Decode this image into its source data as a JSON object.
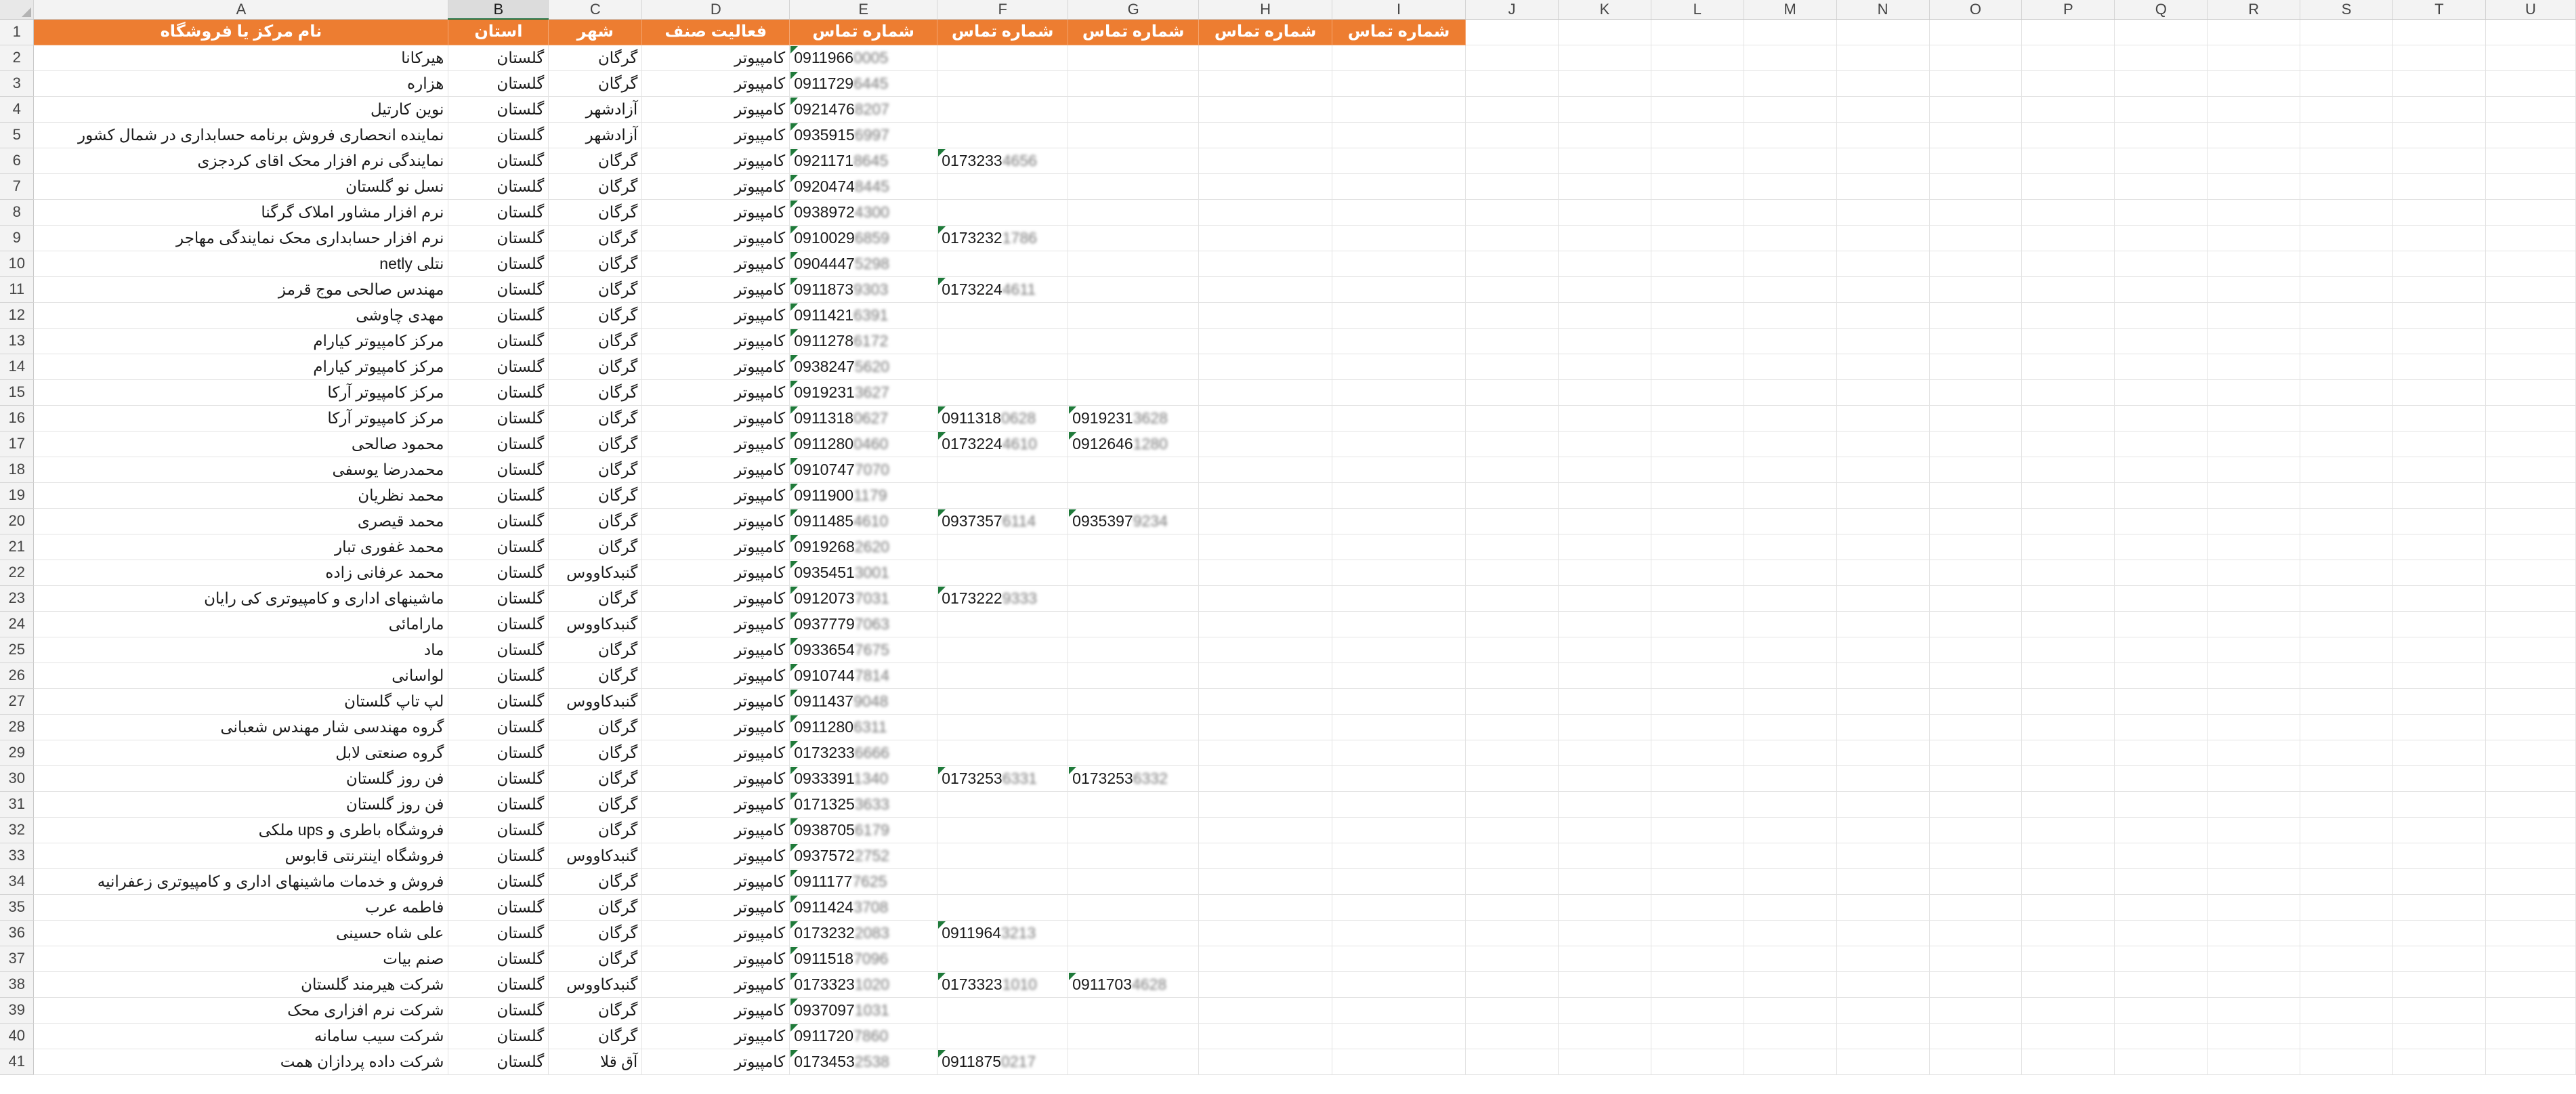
{
  "columns": [
    "A",
    "B",
    "C",
    "D",
    "E",
    "F",
    "G",
    "H",
    "I",
    "J",
    "K",
    "L",
    "M",
    "N",
    "O",
    "P",
    "Q",
    "R",
    "S",
    "T",
    "U"
  ],
  "selected_column": "B",
  "header_row": {
    "number": "1",
    "A": "نام مرکز یا فروشگاه",
    "B": "استان",
    "C": "شهر",
    "D": "فعالیت صنف",
    "E": "شماره تماس",
    "F": "شماره تماس",
    "G": "شماره تماس",
    "H": "شماره تماس",
    "I": "شماره تماس"
  },
  "rows": [
    {
      "n": "2",
      "name": "هیرکانا",
      "province": "گلستان",
      "city": "گرگان",
      "activity": "کامپیوتر",
      "e": "0911966",
      "e_blur": "0005",
      "f": "",
      "f_blur": "",
      "g": "",
      "g_blur": ""
    },
    {
      "n": "3",
      "name": "هزاره",
      "province": "گلستان",
      "city": "گرگان",
      "activity": "کامپیوتر",
      "e": "0911729",
      "e_blur": "6445",
      "f": "",
      "f_blur": "",
      "g": "",
      "g_blur": ""
    },
    {
      "n": "4",
      "name": "نوین کارتیل",
      "province": "گلستان",
      "city": "آزادشهر",
      "activity": "کامپیوتر",
      "e": "0921476",
      "e_blur": "8207",
      "f": "",
      "f_blur": "",
      "g": "",
      "g_blur": ""
    },
    {
      "n": "5",
      "name": "نماینده انحصاری فروش برنامه حسابداری در شمال کشور",
      "province": "گلستان",
      "city": "آزادشهر",
      "activity": "کامپیوتر",
      "e": "0935915",
      "e_blur": "6997",
      "f": "",
      "f_blur": "",
      "g": "",
      "g_blur": ""
    },
    {
      "n": "6",
      "name": "نمایندگی نرم افزار محک اقای کردجزی",
      "province": "گلستان",
      "city": "گرگان",
      "activity": "کامپیوتر",
      "e": "0921171",
      "e_blur": "8645",
      "f": "0173233",
      "f_blur": "4656",
      "g": "",
      "g_blur": ""
    },
    {
      "n": "7",
      "name": "نسل نو گلستان",
      "province": "گلستان",
      "city": "گرگان",
      "activity": "کامپیوتر",
      "e": "0920474",
      "e_blur": "8445",
      "f": "",
      "f_blur": "",
      "g": "",
      "g_blur": ""
    },
    {
      "n": "8",
      "name": "نرم افزار مشاور املاک گرگنا",
      "province": "گلستان",
      "city": "گرگان",
      "activity": "کامپیوتر",
      "e": "0938972",
      "e_blur": "4300",
      "f": "",
      "f_blur": "",
      "g": "",
      "g_blur": ""
    },
    {
      "n": "9",
      "name": "نرم افزار حسابداری محک نمایندگی مهاجر",
      "province": "گلستان",
      "city": "گرگان",
      "activity": "کامپیوتر",
      "e": "0910029",
      "e_blur": "6859",
      "f": "0173232",
      "f_blur": "1786",
      "g": "",
      "g_blur": ""
    },
    {
      "n": "10",
      "name": "نتلی netly",
      "province": "گلستان",
      "city": "گرگان",
      "activity": "کامپیوتر",
      "e": "0904447",
      "e_blur": "5298",
      "f": "",
      "f_blur": "",
      "g": "",
      "g_blur": ""
    },
    {
      "n": "11",
      "name": "مهندس صالحی موج قرمز",
      "province": "گلستان",
      "city": "گرگان",
      "activity": "کامپیوتر",
      "e": "0911873",
      "e_blur": "9303",
      "f": "0173224",
      "f_blur": "4611",
      "g": "",
      "g_blur": ""
    },
    {
      "n": "12",
      "name": "مهدی چاوشی",
      "province": "گلستان",
      "city": "گرگان",
      "activity": "کامپیوتر",
      "e": "0911421",
      "e_blur": "6391",
      "f": "",
      "f_blur": "",
      "g": "",
      "g_blur": ""
    },
    {
      "n": "13",
      "name": "مرکز کامپیوتر کیارام",
      "province": "گلستان",
      "city": "گرگان",
      "activity": "کامپیوتر",
      "e": "0911278",
      "e_blur": "6172",
      "f": "",
      "f_blur": "",
      "g": "",
      "g_blur": ""
    },
    {
      "n": "14",
      "name": "مرکز کامپیوتر کیارام",
      "province": "گلستان",
      "city": "گرگان",
      "activity": "کامپیوتر",
      "e": "0938247",
      "e_blur": "5620",
      "f": "",
      "f_blur": "",
      "g": "",
      "g_blur": ""
    },
    {
      "n": "15",
      "name": "مرکز کامپیوتر آرکا",
      "province": "گلستان",
      "city": "گرگان",
      "activity": "کامپیوتر",
      "e": "0919231",
      "e_blur": "3627",
      "f": "",
      "f_blur": "",
      "g": "",
      "g_blur": ""
    },
    {
      "n": "16",
      "name": "مرکز کامپیوتر آرکا",
      "province": "گلستان",
      "city": "گرگان",
      "activity": "کامپیوتر",
      "e": "0911318",
      "e_blur": "0627",
      "f": "0911318",
      "f_blur": "0628",
      "g": "0919231",
      "g_blur": "3628"
    },
    {
      "n": "17",
      "name": "محمود صالحی",
      "province": "گلستان",
      "city": "گرگان",
      "activity": "کامپیوتر",
      "e": "0911280",
      "e_blur": "0460",
      "f": "0173224",
      "f_blur": "4610",
      "g": "0912646",
      "g_blur": "1280"
    },
    {
      "n": "18",
      "name": "محمدرضا یوسفی",
      "province": "گلستان",
      "city": "گرگان",
      "activity": "کامپیوتر",
      "e": "0910747",
      "e_blur": "7070",
      "f": "",
      "f_blur": "",
      "g": "",
      "g_blur": ""
    },
    {
      "n": "19",
      "name": "محمد نظریان",
      "province": "گلستان",
      "city": "گرگان",
      "activity": "کامپیوتر",
      "e": "0911900",
      "e_blur": "1179",
      "f": "",
      "f_blur": "",
      "g": "",
      "g_blur": ""
    },
    {
      "n": "20",
      "name": "محمد قیصری",
      "province": "گلستان",
      "city": "گرگان",
      "activity": "کامپیوتر",
      "e": "0911485",
      "e_blur": "4610",
      "f": "0937357",
      "f_blur": "6114",
      "g": "0935397",
      "g_blur": "9234"
    },
    {
      "n": "21",
      "name": "محمد غفوری تبار",
      "province": "گلستان",
      "city": "گرگان",
      "activity": "کامپیوتر",
      "e": "0919268",
      "e_blur": "2620",
      "f": "",
      "f_blur": "",
      "g": "",
      "g_blur": ""
    },
    {
      "n": "22",
      "name": "محمد عرفانی زاده",
      "province": "گلستان",
      "city": "گنبدکاووس",
      "activity": "کامپیوتر",
      "e": "0935451",
      "e_blur": "3001",
      "f": "",
      "f_blur": "",
      "g": "",
      "g_blur": ""
    },
    {
      "n": "23",
      "name": "ماشینهای اداری و کامپیوتری کی رایان",
      "province": "گلستان",
      "city": "گرگان",
      "activity": "کامپیوتر",
      "e": "0912073",
      "e_blur": "7031",
      "f": "0173222",
      "f_blur": "9333",
      "g": "",
      "g_blur": ""
    },
    {
      "n": "24",
      "name": "مارامائی",
      "province": "گلستان",
      "city": "گنبدکاووس",
      "activity": "کامپیوتر",
      "e": "0937779",
      "e_blur": "7063",
      "f": "",
      "f_blur": "",
      "g": "",
      "g_blur": ""
    },
    {
      "n": "25",
      "name": "ماد",
      "province": "گلستان",
      "city": "گرگان",
      "activity": "کامپیوتر",
      "e": "0933654",
      "e_blur": "7675",
      "f": "",
      "f_blur": "",
      "g": "",
      "g_blur": ""
    },
    {
      "n": "26",
      "name": "لواسانی",
      "province": "گلستان",
      "city": "گرگان",
      "activity": "کامپیوتر",
      "e": "0910744",
      "e_blur": "7814",
      "f": "",
      "f_blur": "",
      "g": "",
      "g_blur": ""
    },
    {
      "n": "27",
      "name": "لپ تاپ گلستان",
      "province": "گلستان",
      "city": "گنبدکاووس",
      "activity": "کامپیوتر",
      "e": "0911437",
      "e_blur": "9048",
      "f": "",
      "f_blur": "",
      "g": "",
      "g_blur": ""
    },
    {
      "n": "28",
      "name": "گروه مهندسی شار مهندس شعبانی",
      "province": "گلستان",
      "city": "گرگان",
      "activity": "کامپیوتر",
      "e": "0911280",
      "e_blur": "6311",
      "f": "",
      "f_blur": "",
      "g": "",
      "g_blur": ""
    },
    {
      "n": "29",
      "name": "گروه صنعتی لابل",
      "province": "گلستان",
      "city": "گرگان",
      "activity": "کامپیوتر",
      "e": "0173233",
      "e_blur": "6666",
      "f": "",
      "f_blur": "",
      "g": "",
      "g_blur": ""
    },
    {
      "n": "30",
      "name": "فن روز گلستان",
      "province": "گلستان",
      "city": "گرگان",
      "activity": "کامپیوتر",
      "e": "0933391",
      "e_blur": "1340",
      "f": "0173253",
      "f_blur": "6331",
      "g": "0173253",
      "g_blur": "6332"
    },
    {
      "n": "31",
      "name": "فن روز گلستان",
      "province": "گلستان",
      "city": "گرگان",
      "activity": "کامپیوتر",
      "e": "0171325",
      "e_blur": "3633",
      "f": "",
      "f_blur": "",
      "g": "",
      "g_blur": ""
    },
    {
      "n": "32",
      "name": "فروشگاه باطری و ups ملکی",
      "province": "گلستان",
      "city": "گرگان",
      "activity": "کامپیوتر",
      "e": "0938705",
      "e_blur": "6179",
      "f": "",
      "f_blur": "",
      "g": "",
      "g_blur": ""
    },
    {
      "n": "33",
      "name": "فروشگاه اینترنتی قابوس",
      "province": "گلستان",
      "city": "گنبدکاووس",
      "activity": "کامپیوتر",
      "e": "0937572",
      "e_blur": "2752",
      "f": "",
      "f_blur": "",
      "g": "",
      "g_blur": ""
    },
    {
      "n": "34",
      "name": "فروش و خدمات ماشینهای اداری و کامپیوتری زعفرانیه",
      "province": "گلستان",
      "city": "گرگان",
      "activity": "کامپیوتر",
      "e": "0911177",
      "e_blur": "7625",
      "f": "",
      "f_blur": "",
      "g": "",
      "g_blur": ""
    },
    {
      "n": "35",
      "name": "فاطمه عرب",
      "province": "گلستان",
      "city": "گرگان",
      "activity": "کامپیوتر",
      "e": "0911424",
      "e_blur": "3708",
      "f": "",
      "f_blur": "",
      "g": "",
      "g_blur": ""
    },
    {
      "n": "36",
      "name": "علی شاه حسینی",
      "province": "گلستان",
      "city": "گرگان",
      "activity": "کامپیوتر",
      "e": "0173232",
      "e_blur": "2083",
      "f": "0911964",
      "f_blur": "3213",
      "g": "",
      "g_blur": ""
    },
    {
      "n": "37",
      "name": "صنم بیات",
      "province": "گلستان",
      "city": "گرگان",
      "activity": "کامپیوتر",
      "e": "0911518",
      "e_blur": "7096",
      "f": "",
      "f_blur": "",
      "g": "",
      "g_blur": ""
    },
    {
      "n": "38",
      "name": "شرکت هیرمند گلستان",
      "province": "گلستان",
      "city": "گنبدکاووس",
      "activity": "کامپیوتر",
      "e": "0173323",
      "e_blur": "1020",
      "f": "0173323",
      "f_blur": "1010",
      "g": "0911703",
      "g_blur": "4628"
    },
    {
      "n": "39",
      "name": "شرکت نرم افزاری محک",
      "province": "گلستان",
      "city": "گرگان",
      "activity": "کامپیوتر",
      "e": "0937097",
      "e_blur": "1031",
      "f": "",
      "f_blur": "",
      "g": "",
      "g_blur": ""
    },
    {
      "n": "40",
      "name": "شرکت سیب سامانه",
      "province": "گلستان",
      "city": "گرگان",
      "activity": "کامپیوتر",
      "e": "0911720",
      "e_blur": "7860",
      "f": "",
      "f_blur": "",
      "g": "",
      "g_blur": ""
    },
    {
      "n": "41",
      "name": "شرکت داده پردازان همت",
      "province": "گلستان",
      "city": "آق قلا",
      "activity": "کامپیوتر",
      "e": "0173453",
      "e_blur": "2538",
      "f": "0911875",
      "f_blur": "0217",
      "g": "",
      "g_blur": ""
    }
  ]
}
